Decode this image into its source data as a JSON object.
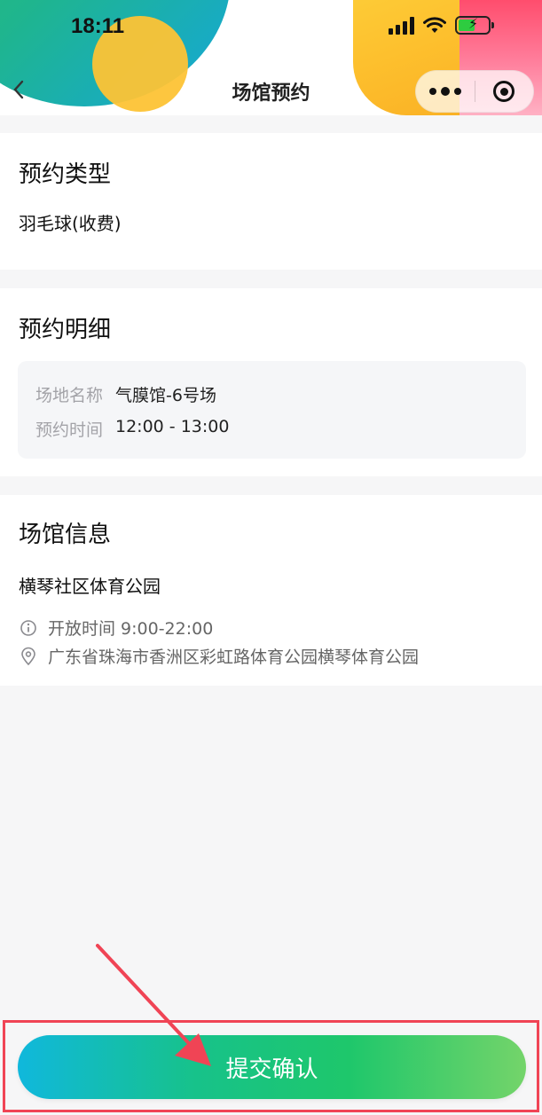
{
  "status_bar": {
    "time": "18:11"
  },
  "nav": {
    "title": "场馆预约"
  },
  "booking_type": {
    "title": "预约类型",
    "value": "羽毛球(收费)"
  },
  "booking_detail": {
    "title": "预约明细",
    "venue_label": "场地名称",
    "venue_value": "气膜馆-6号场",
    "time_label": "预约时间",
    "time_value": "12:00 - 13:00"
  },
  "venue_info": {
    "title": "场馆信息",
    "name": "横琴社区体育公园",
    "hours": "开放时间 9:00-22:00",
    "address": "广东省珠海市香洲区彩虹路体育公园横琴体育公园"
  },
  "submit": {
    "label": "提交确认"
  },
  "colors": {
    "accent_start": "#10b8dc",
    "accent_end": "#74d46a",
    "annotation": "#f04455"
  },
  "icons": [
    "back-chevron-icon",
    "more-dots-icon",
    "close-target-icon",
    "info-icon",
    "location-pin-icon",
    "signal-icon",
    "wifi-icon",
    "battery-charging-icon"
  ]
}
